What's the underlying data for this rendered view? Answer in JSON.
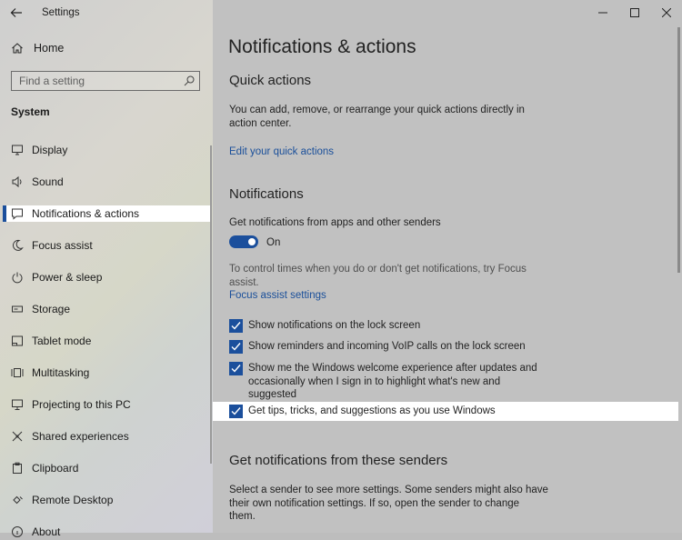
{
  "window": {
    "title": "Settings"
  },
  "sidebar": {
    "home_label": "Home",
    "search_placeholder": "Find a setting",
    "section": "System",
    "items": [
      {
        "label": "Display",
        "icon": "display-icon"
      },
      {
        "label": "Sound",
        "icon": "sound-icon"
      },
      {
        "label": "Notifications & actions",
        "icon": "notifications-icon",
        "selected": true
      },
      {
        "label": "Focus assist",
        "icon": "moon-icon"
      },
      {
        "label": "Power & sleep",
        "icon": "power-icon"
      },
      {
        "label": "Storage",
        "icon": "storage-icon"
      },
      {
        "label": "Tablet mode",
        "icon": "tablet-icon"
      },
      {
        "label": "Multitasking",
        "icon": "multitasking-icon"
      },
      {
        "label": "Projecting to this PC",
        "icon": "projecting-icon"
      },
      {
        "label": "Shared experiences",
        "icon": "shared-icon"
      },
      {
        "label": "Clipboard",
        "icon": "clipboard-icon"
      },
      {
        "label": "Remote Desktop",
        "icon": "remote-desktop-icon"
      },
      {
        "label": "About",
        "icon": "about-icon"
      }
    ]
  },
  "main": {
    "title": "Notifications & actions",
    "quick_actions": {
      "heading": "Quick actions",
      "description_1": "You can add, remove, or rearrange your quick actions directly in",
      "description_2": "action center.",
      "link": "Edit your quick actions"
    },
    "notifications": {
      "heading": "Notifications",
      "toggle_label": "Get notifications from apps and other senders",
      "toggle_state": "On",
      "focus_text_1": "To control times when you do or don't get notifications, try Focus",
      "focus_text_2": "assist.",
      "focus_link": "Focus assist settings",
      "checkboxes": [
        {
          "lines": [
            "Show notifications on the lock screen"
          ],
          "checked": true
        },
        {
          "lines": [
            "Show reminders and incoming VoIP calls on the lock screen"
          ],
          "checked": true
        },
        {
          "lines": [
            "Show me the Windows welcome experience after updates and",
            "occasionally when I sign in to highlight what's new and",
            "suggested"
          ],
          "checked": true
        },
        {
          "lines": [
            "Get tips, tricks, and suggestions as you use Windows"
          ],
          "checked": true
        }
      ]
    },
    "senders": {
      "heading": "Get notifications from these senders",
      "description_1": "Select a sender to see more settings. Some senders might also have",
      "description_2": "their own notification settings. If so, open the sender to change",
      "description_3": "them."
    }
  },
  "colors": {
    "accent": "#1b4f9c",
    "link": "#1a4f9a",
    "highlight": "#ffffff"
  }
}
